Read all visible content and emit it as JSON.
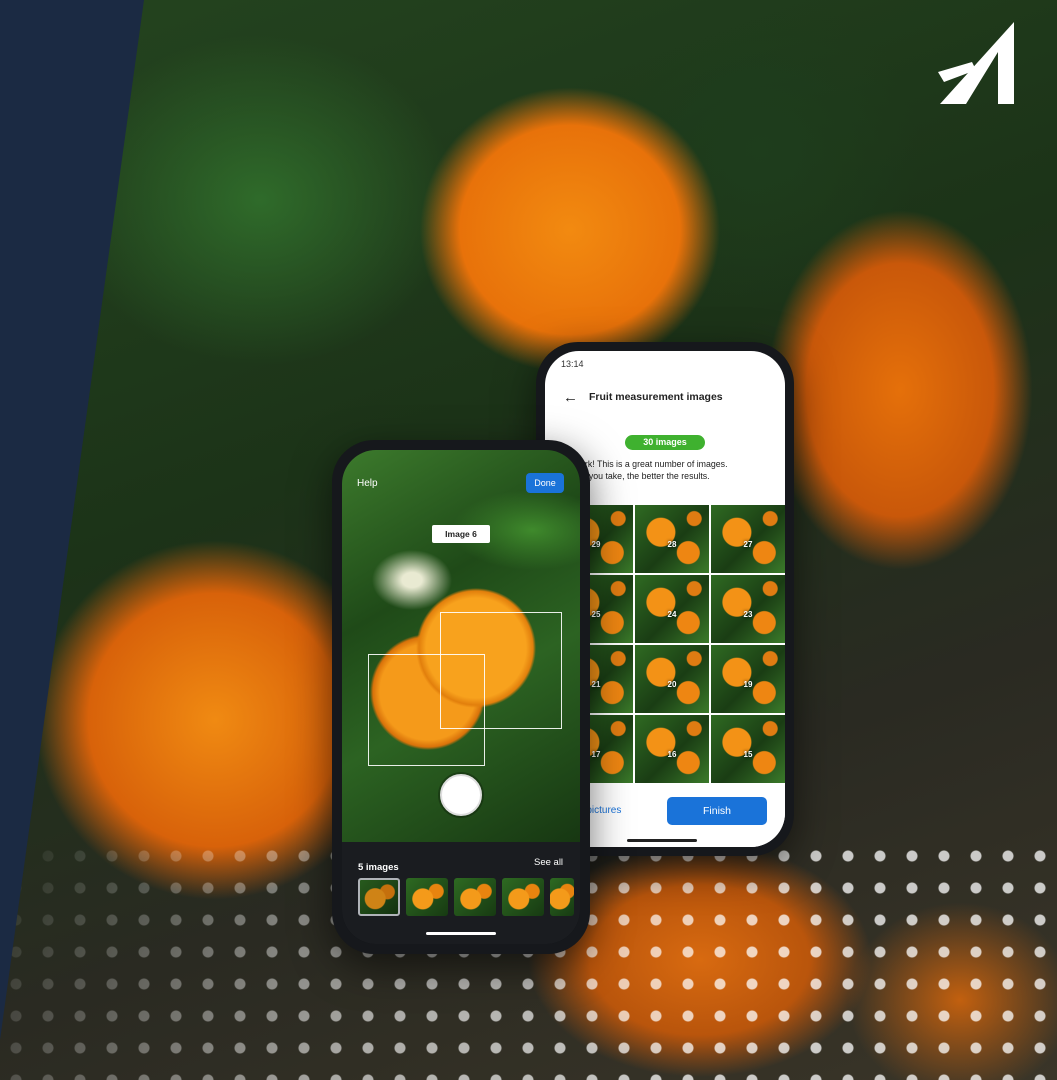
{
  "back_phone": {
    "status_time": "13:14",
    "title": "Fruit measurement images",
    "count_pill": "30 images",
    "message_line1": "ent work! This is a great number of images.",
    "message_line2": "e more you take, the better the results.",
    "grid_numbers": [
      "29",
      "28",
      "27",
      "25",
      "24",
      "23",
      "21",
      "20",
      "19",
      "17",
      "16",
      "15"
    ],
    "take_link": "ke pictures",
    "finish_label": "Finish"
  },
  "front_phone": {
    "help_label": "Help",
    "done_label": "Done",
    "image_label": "Image 6",
    "count_label": "5 images",
    "see_all_label": "See all"
  },
  "colors": {
    "navy": "#1b2a43",
    "accent_blue": "#1a73d9",
    "pill_green": "#3fb12f"
  }
}
